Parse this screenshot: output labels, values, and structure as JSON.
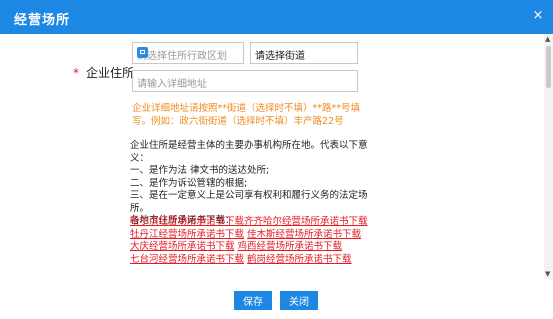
{
  "dialog": {
    "title": "经营场所",
    "close_glyph": "×"
  },
  "form": {
    "required_mark": "*",
    "label": "企业住所:",
    "region_placeholder": "请选择住所行政区划",
    "street_select_value": "请选择街道",
    "address_placeholder": "请输入详细地址",
    "tip_line1": "企业详细地址请按照**街道（选择时不填）**路**号填",
    "tip_line2": "写。例如：政六街街道（选择时不填）丰产路22号"
  },
  "info": {
    "lines": [
      "企业住所是经营主体的主要办事机构所在地。代表以下意",
      "义：",
      "一、是作为法 律文书的送达处所;",
      "二、是作为诉讼管辖的根据;",
      "三、是在一定意义上是公司享有权利和履行义务的法定场",
      "所。",
      "各地市住所承诺书下载："
    ]
  },
  "downloads": [
    "哈尔滨经营场所承诺书下载",
    "齐齐哈尔经营场所承诺书下载",
    "牡丹江经营场所承诺书下载",
    "佳木斯经营场所承诺书下载",
    "大庆经营场所承诺书下载",
    "鸡西经营场所承诺书下载",
    "七台河经营场所承诺书下载",
    "鹤岗经营场所承诺书下载"
  ],
  "footer": {
    "save_label": "保存",
    "close_label": "关闭"
  },
  "colors": {
    "accent": "#1d87e4",
    "link": "#e51c23",
    "tip": "#ef8b21"
  },
  "icons": {
    "close": "close-icon",
    "region_picker": "region-picker-icon",
    "select_arrow": "chevron-down-icon"
  }
}
